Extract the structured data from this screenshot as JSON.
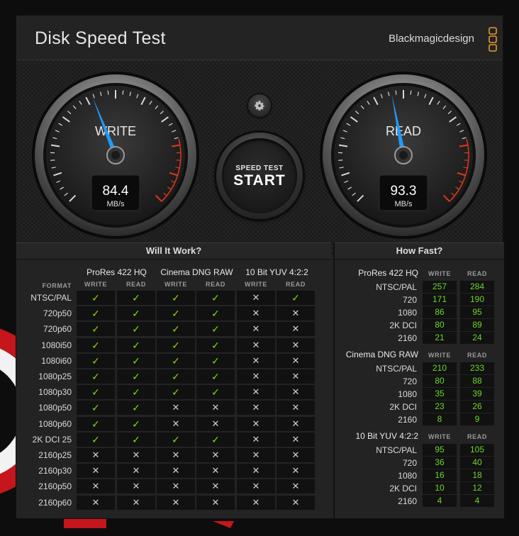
{
  "app": {
    "title": "Disk Speed Test",
    "brand": "Blackmagicdesign",
    "close": "×"
  },
  "colors": {
    "accent_blue": "#1e9bff",
    "check_green": "#7be01c",
    "value_green": "#6cd628",
    "redline": "#e0391e"
  },
  "gauges": {
    "write": {
      "label": "WRITE",
      "value": "84.4",
      "unit": "MB/s",
      "needle_fraction": 0.42
    },
    "read": {
      "label": "READ",
      "value": "93.3",
      "unit": "MB/s",
      "needle_fraction": 0.46
    }
  },
  "controls": {
    "settings_icon": "gear-icon",
    "start_top": "SPEED TEST",
    "start_main": "START"
  },
  "will_it_work": {
    "title": "Will It Work?",
    "format_header": "FORMAT",
    "write_header": "WRITE",
    "read_header": "READ",
    "codecs": [
      "ProRes 422 HQ",
      "Cinema DNG RAW",
      "10 Bit YUV 4:2:2"
    ],
    "rows": [
      {
        "format": "NTSC/PAL",
        "cells": [
          1,
          1,
          1,
          1,
          0,
          1
        ]
      },
      {
        "format": "720p50",
        "cells": [
          1,
          1,
          1,
          1,
          0,
          0
        ]
      },
      {
        "format": "720p60",
        "cells": [
          1,
          1,
          1,
          1,
          0,
          0
        ]
      },
      {
        "format": "1080i50",
        "cells": [
          1,
          1,
          1,
          1,
          0,
          0
        ]
      },
      {
        "format": "1080i60",
        "cells": [
          1,
          1,
          1,
          1,
          0,
          0
        ]
      },
      {
        "format": "1080p25",
        "cells": [
          1,
          1,
          1,
          1,
          0,
          0
        ]
      },
      {
        "format": "1080p30",
        "cells": [
          1,
          1,
          1,
          1,
          0,
          0
        ]
      },
      {
        "format": "1080p50",
        "cells": [
          1,
          1,
          0,
          0,
          0,
          0
        ]
      },
      {
        "format": "1080p60",
        "cells": [
          1,
          1,
          0,
          0,
          0,
          0
        ]
      },
      {
        "format": "2K DCI 25",
        "cells": [
          1,
          1,
          1,
          1,
          0,
          0
        ]
      },
      {
        "format": "2160p25",
        "cells": [
          0,
          0,
          0,
          0,
          0,
          0
        ]
      },
      {
        "format": "2160p30",
        "cells": [
          0,
          0,
          0,
          0,
          0,
          0
        ]
      },
      {
        "format": "2160p50",
        "cells": [
          0,
          0,
          0,
          0,
          0,
          0
        ]
      },
      {
        "format": "2160p60",
        "cells": [
          0,
          0,
          0,
          0,
          0,
          0
        ]
      }
    ],
    "check_glyph": "✓",
    "cross_glyph": "✕"
  },
  "how_fast": {
    "title": "How Fast?",
    "write_header": "WRITE",
    "read_header": "READ",
    "groups": [
      {
        "codec": "ProRes 422 HQ",
        "rows": [
          {
            "format": "NTSC/PAL",
            "write": "257",
            "read": "284"
          },
          {
            "format": "720",
            "write": "171",
            "read": "190"
          },
          {
            "format": "1080",
            "write": "86",
            "read": "95"
          },
          {
            "format": "2K DCI",
            "write": "80",
            "read": "89"
          },
          {
            "format": "2160",
            "write": "21",
            "read": "24"
          }
        ]
      },
      {
        "codec": "Cinema DNG RAW",
        "rows": [
          {
            "format": "NTSC/PAL",
            "write": "210",
            "read": "233"
          },
          {
            "format": "720",
            "write": "80",
            "read": "88"
          },
          {
            "format": "1080",
            "write": "35",
            "read": "39"
          },
          {
            "format": "2K DCI",
            "write": "23",
            "read": "26"
          },
          {
            "format": "2160",
            "write": "8",
            "read": "9"
          }
        ]
      },
      {
        "codec": "10 Bit YUV 4:2:2",
        "rows": [
          {
            "format": "NTSC/PAL",
            "write": "95",
            "read": "105"
          },
          {
            "format": "720",
            "write": "36",
            "read": "40"
          },
          {
            "format": "1080",
            "write": "16",
            "read": "18"
          },
          {
            "format": "2K DCI",
            "write": "10",
            "read": "12"
          },
          {
            "format": "2160",
            "write": "4",
            "read": "4"
          }
        ]
      }
    ]
  }
}
